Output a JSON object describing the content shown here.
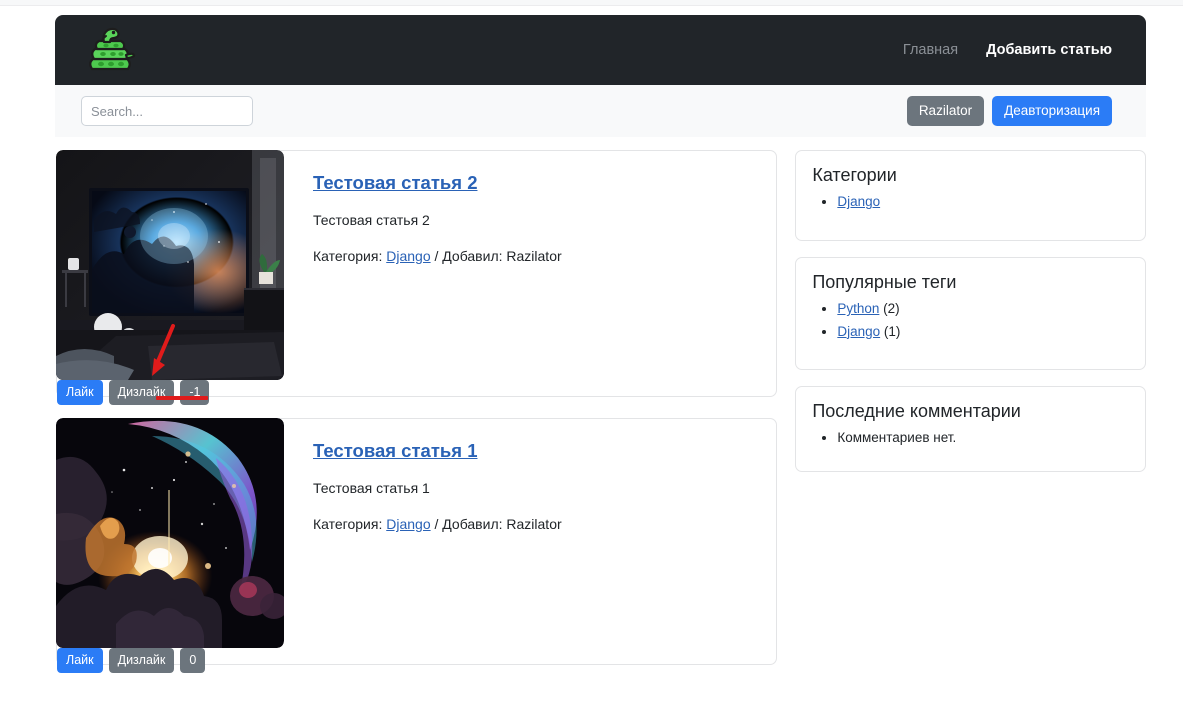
{
  "site": {
    "logo_icon": "green-snake-logo"
  },
  "nav": {
    "links": [
      {
        "label": "Главная",
        "active": false
      },
      {
        "label": "Добавить статью",
        "active": true
      }
    ]
  },
  "search": {
    "placeholder": "Search...",
    "value": ""
  },
  "account": {
    "username_button": "Razilator",
    "logout_button": "Деавторизация"
  },
  "articles": [
    {
      "title": "Тестовая статья 2",
      "excerpt": "Тестовая статья 2",
      "meta_prefix": "Категория: ",
      "category": "Django",
      "meta_middle": " / Добавил: ",
      "author": "Razilator",
      "like_label": "Лайк",
      "dislike_label": "Дизлайк",
      "rating": "-1",
      "image_alt": "dark-bedroom-with-nebula-artwork"
    },
    {
      "title": "Тестовая статья 1",
      "excerpt": "Тестовая статья 1",
      "meta_prefix": "Категория: ",
      "category": "Django",
      "meta_middle": " / Добавил: ",
      "author": "Razilator",
      "like_label": "Лайк",
      "dislike_label": "Дизлайк",
      "rating": "0",
      "image_alt": "colorful-nebula-with-golden-core"
    }
  ],
  "sidebar": {
    "categories": {
      "title": "Категории",
      "items": [
        {
          "label": "Django"
        }
      ]
    },
    "tags": {
      "title": "Популярные теги",
      "items": [
        {
          "label": "Python",
          "count": " (2)"
        },
        {
          "label": "Django",
          "count": " (1)"
        }
      ]
    },
    "comments": {
      "title": "Последние комментарии",
      "items": [
        {
          "label": "Комментариев нет."
        }
      ]
    }
  },
  "colors": {
    "navbar_bg": "#212529",
    "subbar_bg": "#f8f9fa",
    "primary": "#2b7cf6",
    "secondary": "#6c757d",
    "link": "#2a62b6",
    "annotation": "#e01b1b",
    "logo_green": "#4ec94e"
  }
}
